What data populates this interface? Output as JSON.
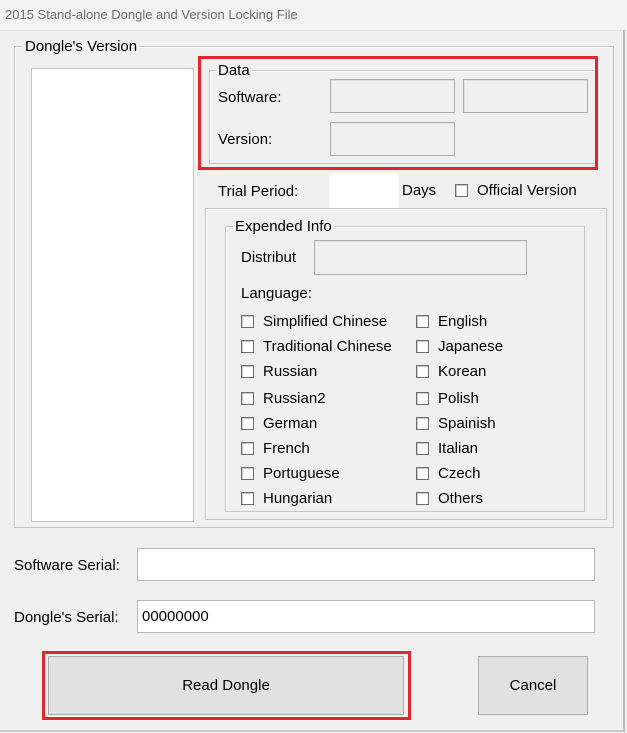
{
  "window": {
    "title": "2015 Stand-alone Dongle and Version Locking File"
  },
  "dongle_version_group": {
    "legend": "Dongle's Version"
  },
  "data_group": {
    "legend": "Data",
    "software_label": "Software:",
    "version_label": "Version:",
    "software_value_1": "",
    "software_value_2": "",
    "version_value": ""
  },
  "trial": {
    "label": "Trial Period:",
    "value": "",
    "unit": "Days",
    "official_label": "Official Version"
  },
  "expended_info": {
    "legend": "Expended Info",
    "distribut_label": "Distribut",
    "distribut_value": "",
    "language_label": "Language:",
    "languages_left": [
      "Simplified Chinese",
      "Traditional Chinese",
      "Russian",
      "Russian2",
      "German",
      "French",
      "Portuguese",
      "Hungarian"
    ],
    "languages_right": [
      "English",
      "Japanese",
      "Korean",
      "Polish",
      "Spainish",
      "Italian",
      "Czech",
      "Others"
    ]
  },
  "software_serial": {
    "label": "Software Serial:",
    "value": ""
  },
  "dongle_serial": {
    "label": "Dongle's Serial:",
    "value": "00000000"
  },
  "buttons": {
    "read": "Read Dongle",
    "cancel": "Cancel"
  },
  "colors": {
    "highlight": "#e3262e",
    "background": "#f0f0f0"
  }
}
